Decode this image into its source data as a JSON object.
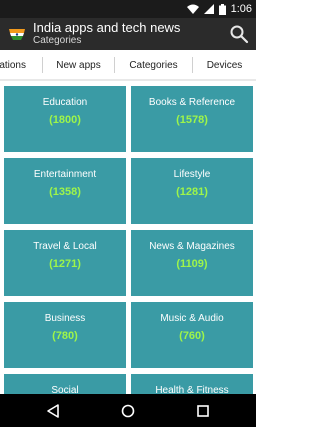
{
  "status_bar": {
    "time": "1:06",
    "icons": [
      "wifi-icon",
      "signal-icon",
      "battery-icon"
    ]
  },
  "app_bar": {
    "title": "India apps and tech news",
    "subtitle": "Categories",
    "logo": "india-flag-icon",
    "search_icon": "search-icon"
  },
  "tabs": [
    {
      "label": "ations"
    },
    {
      "label": "New apps"
    },
    {
      "label": "Categories"
    },
    {
      "label": "Devices"
    }
  ],
  "categories": [
    {
      "name": "Education",
      "count": "(1800)"
    },
    {
      "name": "Books & Reference",
      "count": "(1578)"
    },
    {
      "name": "Entertainment",
      "count": "(1358)"
    },
    {
      "name": "Lifestyle",
      "count": "(1281)"
    },
    {
      "name": "Travel & Local",
      "count": "(1271)"
    },
    {
      "name": "News & Magazines",
      "count": "(1109)"
    },
    {
      "name": "Business",
      "count": "(780)"
    },
    {
      "name": "Music & Audio",
      "count": "(760)"
    },
    {
      "name": "Social",
      "count": ""
    },
    {
      "name": "Health & Fitness",
      "count": ""
    }
  ],
  "colors": {
    "tile_bg": "#3a9ba5",
    "count_text": "#9ef54a",
    "app_bar_bg": "#2b2b2b"
  },
  "nav_bar": {
    "icons": [
      "back-icon",
      "home-icon",
      "recents-icon"
    ]
  }
}
